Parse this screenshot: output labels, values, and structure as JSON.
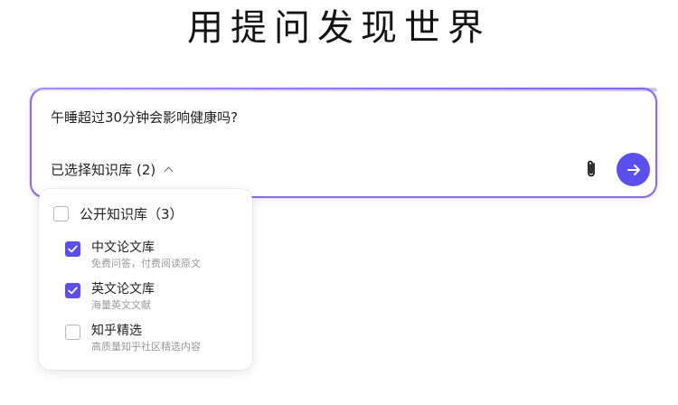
{
  "hero": {
    "title": "用提问发现世界"
  },
  "ask": {
    "question": "午睡超过30分钟会影响健康吗?",
    "kb_label": "已选择知识库",
    "kb_count": "(2)"
  },
  "dropdown": {
    "group_label": "公开知识库",
    "group_count": "（3）",
    "items": [
      {
        "title": "中文论文库",
        "desc": "免费问答，付费阅读原文",
        "checked": true
      },
      {
        "title": "英文论文库",
        "desc": "海量英文文献",
        "checked": true
      },
      {
        "title": "知乎精选",
        "desc": "高质量知乎社区精选内容",
        "checked": false
      }
    ]
  },
  "colors": {
    "accent": "#5b4ff0",
    "border_gradient_start": "#c9b6ff",
    "border_gradient_end": "#6a5ae8"
  },
  "icons": {
    "attach": "paperclip-icon",
    "send": "arrow-right-icon",
    "toggle": "chevron-up-icon",
    "check": "check-icon"
  }
}
